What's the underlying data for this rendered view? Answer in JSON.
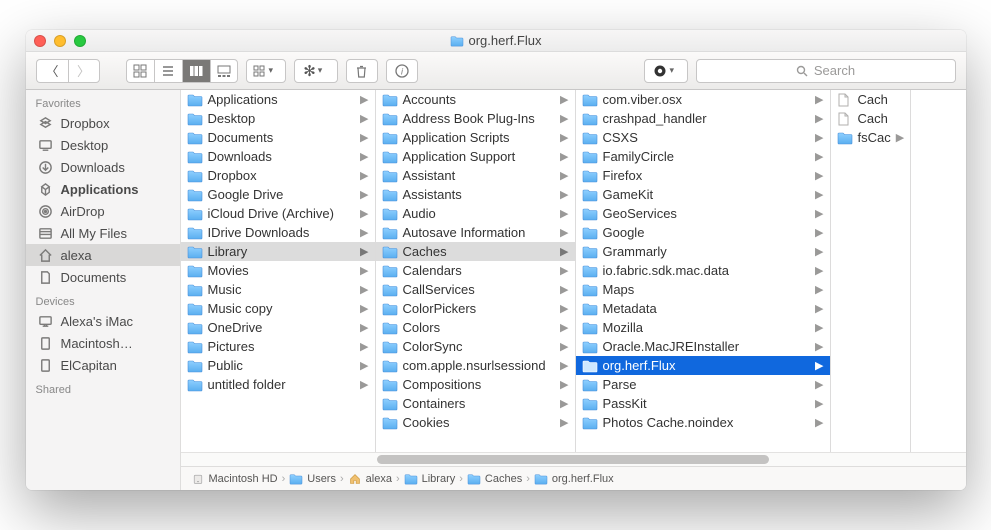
{
  "window": {
    "title": "org.herf.Flux"
  },
  "toolbar": {
    "search_placeholder": "Search"
  },
  "sidebar": {
    "sections": [
      {
        "title": "Favorites",
        "items": [
          {
            "label": "Dropbox",
            "icon": "dropbox"
          },
          {
            "label": "Desktop",
            "icon": "desktop"
          },
          {
            "label": "Downloads",
            "icon": "downloads"
          },
          {
            "label": "Applications",
            "icon": "apps",
            "bold": true
          },
          {
            "label": "AirDrop",
            "icon": "airdrop"
          },
          {
            "label": "All My Files",
            "icon": "allfiles"
          },
          {
            "label": "alexa",
            "icon": "home",
            "selected": true
          },
          {
            "label": "Documents",
            "icon": "docs"
          }
        ]
      },
      {
        "title": "Devices",
        "items": [
          {
            "label": "Alexa's iMac",
            "icon": "imac"
          },
          {
            "label": "Macintosh…",
            "icon": "hdd"
          },
          {
            "label": "ElCapitan",
            "icon": "hdd"
          }
        ]
      },
      {
        "title": "Shared",
        "items": []
      }
    ]
  },
  "columns": [
    {
      "items": [
        {
          "label": "Applications",
          "icon": "folder"
        },
        {
          "label": "Desktop",
          "icon": "folder"
        },
        {
          "label": "Documents",
          "icon": "folder"
        },
        {
          "label": "Downloads",
          "icon": "folder"
        },
        {
          "label": "Dropbox",
          "icon": "folder"
        },
        {
          "label": "Google Drive",
          "icon": "folder"
        },
        {
          "label": "iCloud Drive (Archive)",
          "icon": "folder"
        },
        {
          "label": "IDrive Downloads",
          "icon": "folder"
        },
        {
          "label": "Library",
          "icon": "folder",
          "sel": "path"
        },
        {
          "label": "Movies",
          "icon": "folder"
        },
        {
          "label": "Music",
          "icon": "folder"
        },
        {
          "label": "Music copy",
          "icon": "folder"
        },
        {
          "label": "OneDrive",
          "icon": "folder"
        },
        {
          "label": "Pictures",
          "icon": "folder"
        },
        {
          "label": "Public",
          "icon": "folder"
        },
        {
          "label": "untitled folder",
          "icon": "folder"
        }
      ]
    },
    {
      "items": [
        {
          "label": "Accounts",
          "icon": "folder"
        },
        {
          "label": "Address Book Plug-Ins",
          "icon": "folder"
        },
        {
          "label": "Application Scripts",
          "icon": "folder"
        },
        {
          "label": "Application Support",
          "icon": "folder"
        },
        {
          "label": "Assistant",
          "icon": "folder"
        },
        {
          "label": "Assistants",
          "icon": "folder"
        },
        {
          "label": "Audio",
          "icon": "folder"
        },
        {
          "label": "Autosave Information",
          "icon": "folder"
        },
        {
          "label": "Caches",
          "icon": "folder",
          "sel": "path"
        },
        {
          "label": "Calendars",
          "icon": "folder"
        },
        {
          "label": "CallServices",
          "icon": "folder"
        },
        {
          "label": "ColorPickers",
          "icon": "folder"
        },
        {
          "label": "Colors",
          "icon": "folder"
        },
        {
          "label": "ColorSync",
          "icon": "folder"
        },
        {
          "label": "com.apple.nsurlsessiond",
          "icon": "folder"
        },
        {
          "label": "Compositions",
          "icon": "folder"
        },
        {
          "label": "Containers",
          "icon": "folder"
        },
        {
          "label": "Cookies",
          "icon": "folder"
        }
      ]
    },
    {
      "items": [
        {
          "label": "com.viber.osx",
          "icon": "folder"
        },
        {
          "label": "crashpad_handler",
          "icon": "folder"
        },
        {
          "label": "CSXS",
          "icon": "folder"
        },
        {
          "label": "FamilyCircle",
          "icon": "folder"
        },
        {
          "label": "Firefox",
          "icon": "folder"
        },
        {
          "label": "GameKit",
          "icon": "folder"
        },
        {
          "label": "GeoServices",
          "icon": "folder"
        },
        {
          "label": "Google",
          "icon": "folder"
        },
        {
          "label": "Grammarly",
          "icon": "folder"
        },
        {
          "label": "io.fabric.sdk.mac.data",
          "icon": "folder"
        },
        {
          "label": "Maps",
          "icon": "folder"
        },
        {
          "label": "Metadata",
          "icon": "folder"
        },
        {
          "label": "Mozilla",
          "icon": "folder"
        },
        {
          "label": "Oracle.MacJREInstaller",
          "icon": "folder"
        },
        {
          "label": "org.herf.Flux",
          "icon": "folder",
          "sel": "active"
        },
        {
          "label": "Parse",
          "icon": "folder"
        },
        {
          "label": "PassKit",
          "icon": "folder"
        },
        {
          "label": "Photos Cache.noindex",
          "icon": "folder"
        }
      ]
    },
    {
      "items": [
        {
          "label": "Cach",
          "icon": "doc",
          "noarrow": true
        },
        {
          "label": "Cach",
          "icon": "doc",
          "noarrow": true
        },
        {
          "label": "fsCac",
          "icon": "folder"
        }
      ]
    }
  ],
  "pathbar": [
    {
      "label": "Macintosh HD",
      "icon": "hdd"
    },
    {
      "label": "Users",
      "icon": "folder"
    },
    {
      "label": "alexa",
      "icon": "home"
    },
    {
      "label": "Library",
      "icon": "folder"
    },
    {
      "label": "Caches",
      "icon": "folder"
    },
    {
      "label": "org.herf.Flux",
      "icon": "folder"
    }
  ]
}
